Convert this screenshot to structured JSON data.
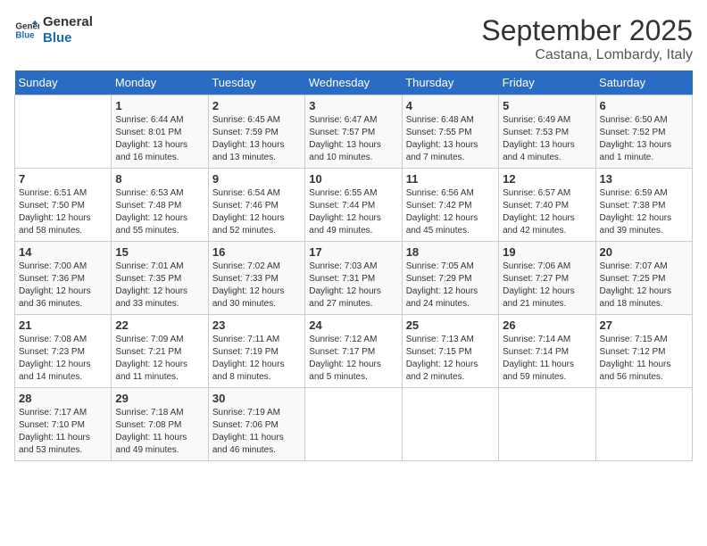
{
  "header": {
    "logo_line1": "General",
    "logo_line2": "Blue",
    "month": "September 2025",
    "location": "Castana, Lombardy, Italy"
  },
  "weekdays": [
    "Sunday",
    "Monday",
    "Tuesday",
    "Wednesday",
    "Thursday",
    "Friday",
    "Saturday"
  ],
  "weeks": [
    [
      {
        "day": "",
        "info": ""
      },
      {
        "day": "1",
        "info": "Sunrise: 6:44 AM\nSunset: 8:01 PM\nDaylight: 13 hours\nand 16 minutes."
      },
      {
        "day": "2",
        "info": "Sunrise: 6:45 AM\nSunset: 7:59 PM\nDaylight: 13 hours\nand 13 minutes."
      },
      {
        "day": "3",
        "info": "Sunrise: 6:47 AM\nSunset: 7:57 PM\nDaylight: 13 hours\nand 10 minutes."
      },
      {
        "day": "4",
        "info": "Sunrise: 6:48 AM\nSunset: 7:55 PM\nDaylight: 13 hours\nand 7 minutes."
      },
      {
        "day": "5",
        "info": "Sunrise: 6:49 AM\nSunset: 7:53 PM\nDaylight: 13 hours\nand 4 minutes."
      },
      {
        "day": "6",
        "info": "Sunrise: 6:50 AM\nSunset: 7:52 PM\nDaylight: 13 hours\nand 1 minute."
      }
    ],
    [
      {
        "day": "7",
        "info": "Sunrise: 6:51 AM\nSunset: 7:50 PM\nDaylight: 12 hours\nand 58 minutes."
      },
      {
        "day": "8",
        "info": "Sunrise: 6:53 AM\nSunset: 7:48 PM\nDaylight: 12 hours\nand 55 minutes."
      },
      {
        "day": "9",
        "info": "Sunrise: 6:54 AM\nSunset: 7:46 PM\nDaylight: 12 hours\nand 52 minutes."
      },
      {
        "day": "10",
        "info": "Sunrise: 6:55 AM\nSunset: 7:44 PM\nDaylight: 12 hours\nand 49 minutes."
      },
      {
        "day": "11",
        "info": "Sunrise: 6:56 AM\nSunset: 7:42 PM\nDaylight: 12 hours\nand 45 minutes."
      },
      {
        "day": "12",
        "info": "Sunrise: 6:57 AM\nSunset: 7:40 PM\nDaylight: 12 hours\nand 42 minutes."
      },
      {
        "day": "13",
        "info": "Sunrise: 6:59 AM\nSunset: 7:38 PM\nDaylight: 12 hours\nand 39 minutes."
      }
    ],
    [
      {
        "day": "14",
        "info": "Sunrise: 7:00 AM\nSunset: 7:36 PM\nDaylight: 12 hours\nand 36 minutes."
      },
      {
        "day": "15",
        "info": "Sunrise: 7:01 AM\nSunset: 7:35 PM\nDaylight: 12 hours\nand 33 minutes."
      },
      {
        "day": "16",
        "info": "Sunrise: 7:02 AM\nSunset: 7:33 PM\nDaylight: 12 hours\nand 30 minutes."
      },
      {
        "day": "17",
        "info": "Sunrise: 7:03 AM\nSunset: 7:31 PM\nDaylight: 12 hours\nand 27 minutes."
      },
      {
        "day": "18",
        "info": "Sunrise: 7:05 AM\nSunset: 7:29 PM\nDaylight: 12 hours\nand 24 minutes."
      },
      {
        "day": "19",
        "info": "Sunrise: 7:06 AM\nSunset: 7:27 PM\nDaylight: 12 hours\nand 21 minutes."
      },
      {
        "day": "20",
        "info": "Sunrise: 7:07 AM\nSunset: 7:25 PM\nDaylight: 12 hours\nand 18 minutes."
      }
    ],
    [
      {
        "day": "21",
        "info": "Sunrise: 7:08 AM\nSunset: 7:23 PM\nDaylight: 12 hours\nand 14 minutes."
      },
      {
        "day": "22",
        "info": "Sunrise: 7:09 AM\nSunset: 7:21 PM\nDaylight: 12 hours\nand 11 minutes."
      },
      {
        "day": "23",
        "info": "Sunrise: 7:11 AM\nSunset: 7:19 PM\nDaylight: 12 hours\nand 8 minutes."
      },
      {
        "day": "24",
        "info": "Sunrise: 7:12 AM\nSunset: 7:17 PM\nDaylight: 12 hours\nand 5 minutes."
      },
      {
        "day": "25",
        "info": "Sunrise: 7:13 AM\nSunset: 7:15 PM\nDaylight: 12 hours\nand 2 minutes."
      },
      {
        "day": "26",
        "info": "Sunrise: 7:14 AM\nSunset: 7:14 PM\nDaylight: 11 hours\nand 59 minutes."
      },
      {
        "day": "27",
        "info": "Sunrise: 7:15 AM\nSunset: 7:12 PM\nDaylight: 11 hours\nand 56 minutes."
      }
    ],
    [
      {
        "day": "28",
        "info": "Sunrise: 7:17 AM\nSunset: 7:10 PM\nDaylight: 11 hours\nand 53 minutes."
      },
      {
        "day": "29",
        "info": "Sunrise: 7:18 AM\nSunset: 7:08 PM\nDaylight: 11 hours\nand 49 minutes."
      },
      {
        "day": "30",
        "info": "Sunrise: 7:19 AM\nSunset: 7:06 PM\nDaylight: 11 hours\nand 46 minutes."
      },
      {
        "day": "",
        "info": ""
      },
      {
        "day": "",
        "info": ""
      },
      {
        "day": "",
        "info": ""
      },
      {
        "day": "",
        "info": ""
      }
    ]
  ]
}
